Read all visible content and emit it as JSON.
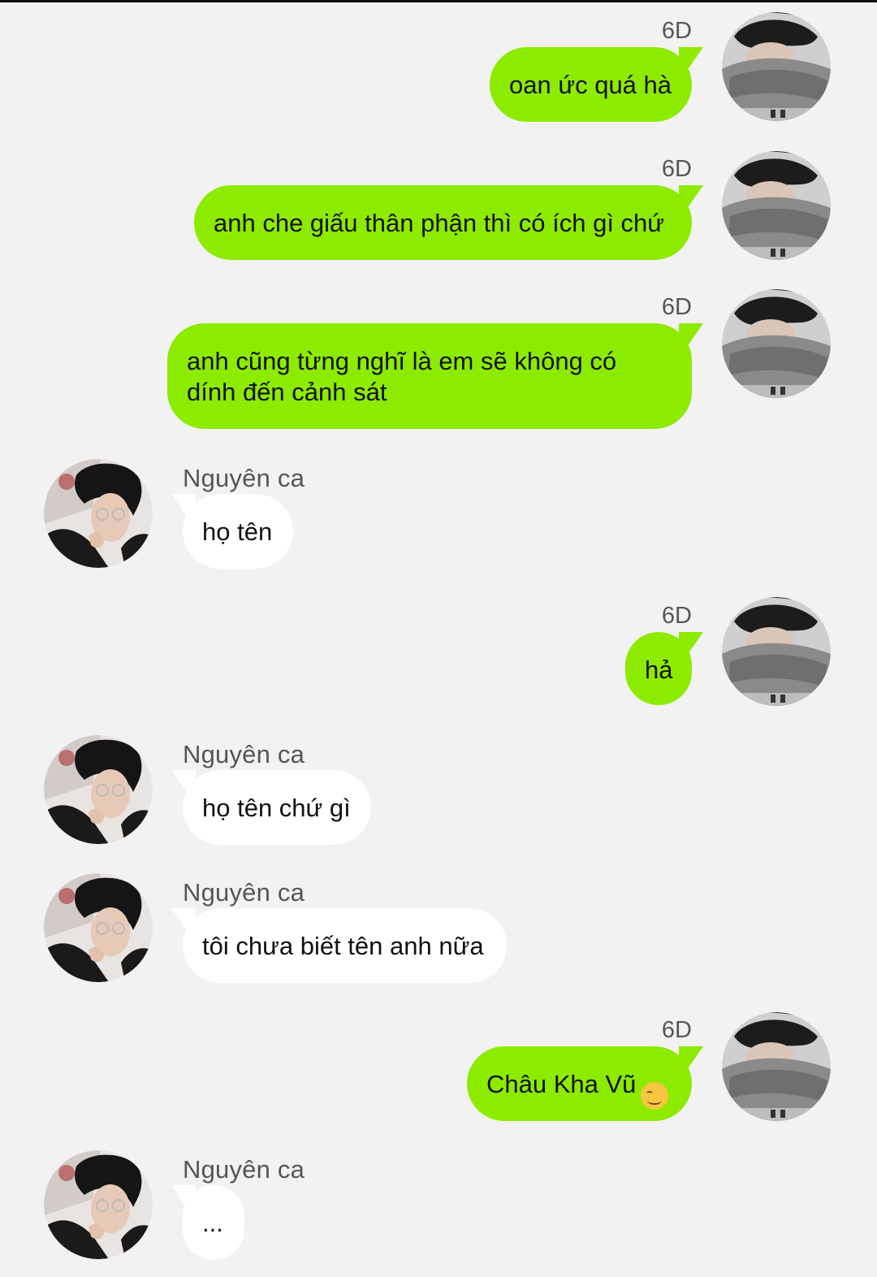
{
  "colors": {
    "background": "#f2f2f2",
    "outgoing_bubble": "#8deb00",
    "incoming_bubble": "#ffffff",
    "meta_text": "#555555",
    "message_text": "#111111"
  },
  "conversation": {
    "messages": [
      {
        "direction": "outgoing",
        "time": "6D",
        "text": "oan ức quá hà",
        "avatar_icon": "masked-user-avatar"
      },
      {
        "direction": "outgoing",
        "time": "6D",
        "text": "anh che giấu thân phận thì có ích gì chứ",
        "avatar_icon": "masked-user-avatar"
      },
      {
        "direction": "outgoing",
        "time": "6D",
        "text_lines": [
          "anh cũng từng nghĩ là em sẽ không có",
          "dính đến cảnh sát"
        ],
        "avatar_icon": "masked-user-avatar"
      },
      {
        "direction": "incoming",
        "sender": "Nguyên ca",
        "text": "họ tên",
        "avatar_icon": "contact-avatar"
      },
      {
        "direction": "outgoing",
        "time": "6D",
        "text": "hả",
        "avatar_icon": "masked-user-avatar"
      },
      {
        "direction": "incoming",
        "sender": "Nguyên ca",
        "text": "họ tên chứ gì",
        "avatar_icon": "contact-avatar"
      },
      {
        "direction": "incoming",
        "sender": "Nguyên ca",
        "text": "tôi chưa biết tên anh nữa",
        "avatar_icon": "contact-avatar"
      },
      {
        "direction": "outgoing",
        "time": "6D",
        "text": "Châu Kha Vũ",
        "emoji": "☺️",
        "emoji_icon": "smiling-face-emoji-icon",
        "avatar_icon": "masked-user-avatar"
      },
      {
        "direction": "incoming",
        "sender": "Nguyên ca",
        "text": "...",
        "avatar_icon": "contact-avatar"
      }
    ]
  }
}
